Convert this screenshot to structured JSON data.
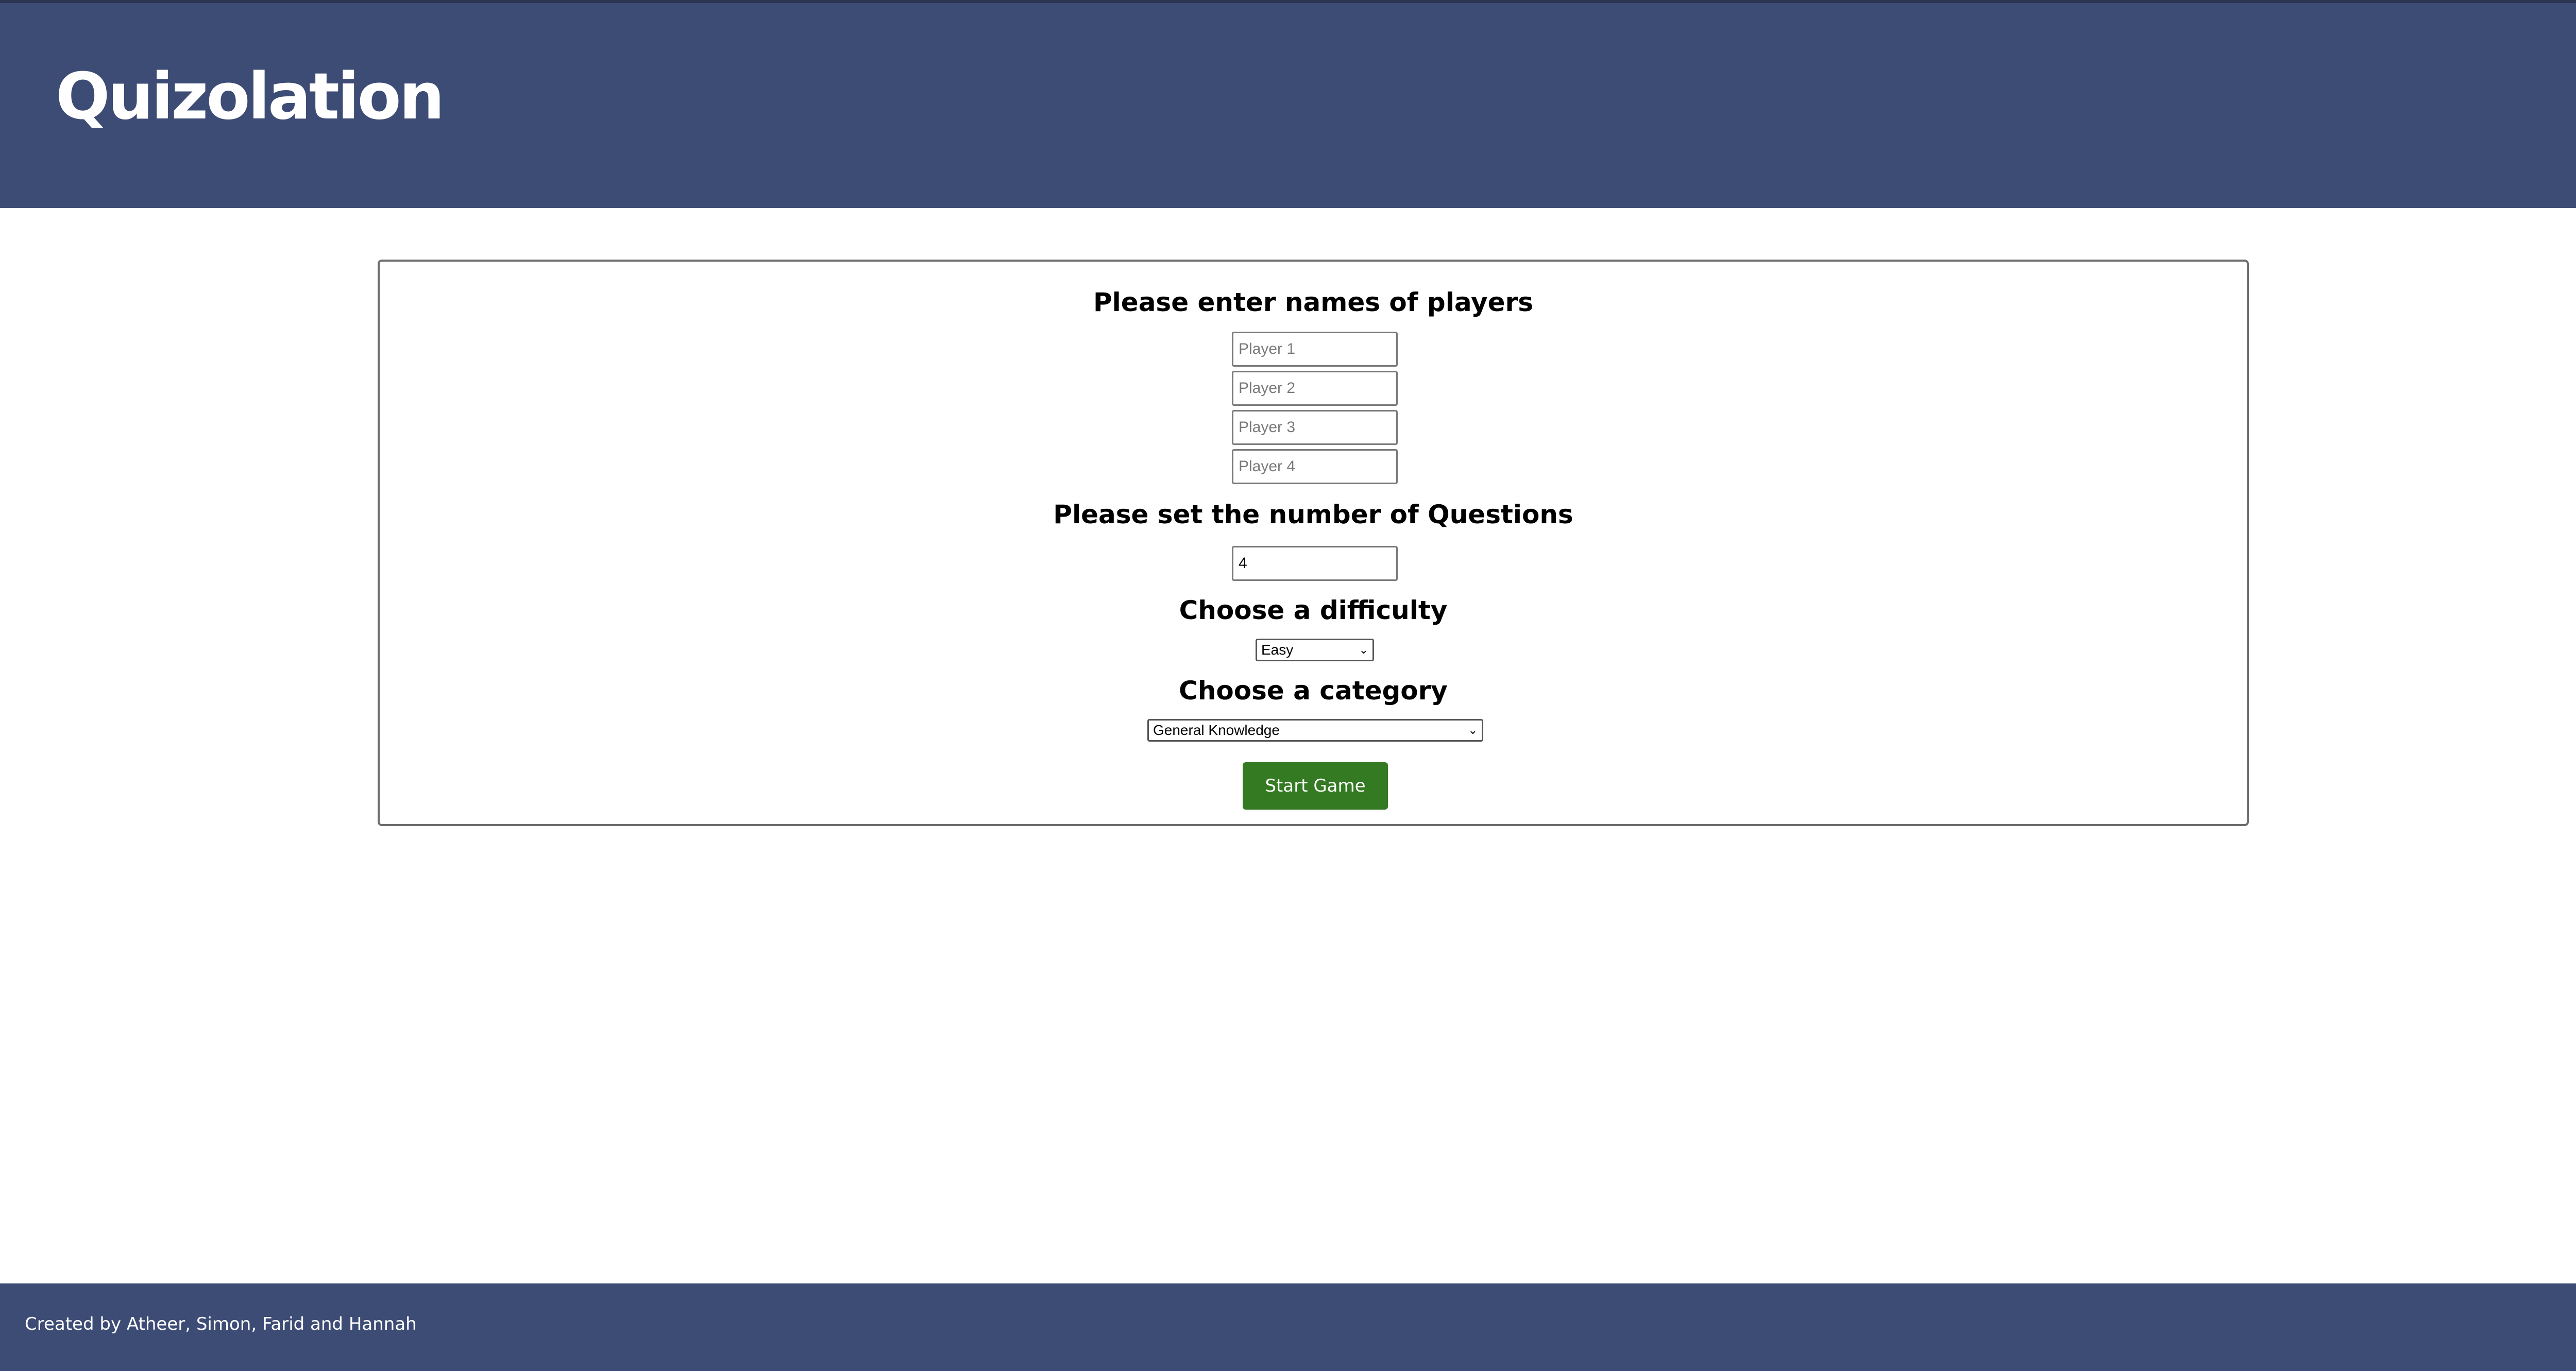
{
  "header": {
    "title": "Quizolation"
  },
  "setup": {
    "players_heading": "Please enter names of players",
    "players": [
      {
        "placeholder": "Player 1",
        "value": ""
      },
      {
        "placeholder": "Player 2",
        "value": ""
      },
      {
        "placeholder": "Player 3",
        "value": ""
      },
      {
        "placeholder": "Player 4",
        "value": ""
      }
    ],
    "questions_heading": "Please set the number of Questions",
    "questions_value": "4",
    "difficulty_heading": "Choose a difficulty",
    "difficulty_selected": "Easy",
    "category_heading": "Choose a category",
    "category_selected": "General Knowledge",
    "start_label": "Start Game"
  },
  "footer": {
    "credits": "Created by Atheer, Simon, Farid and Hannah"
  },
  "colors": {
    "header_bg": "#3d4c75",
    "footer_bg": "#3d4c75",
    "start_button": "#347a22"
  }
}
